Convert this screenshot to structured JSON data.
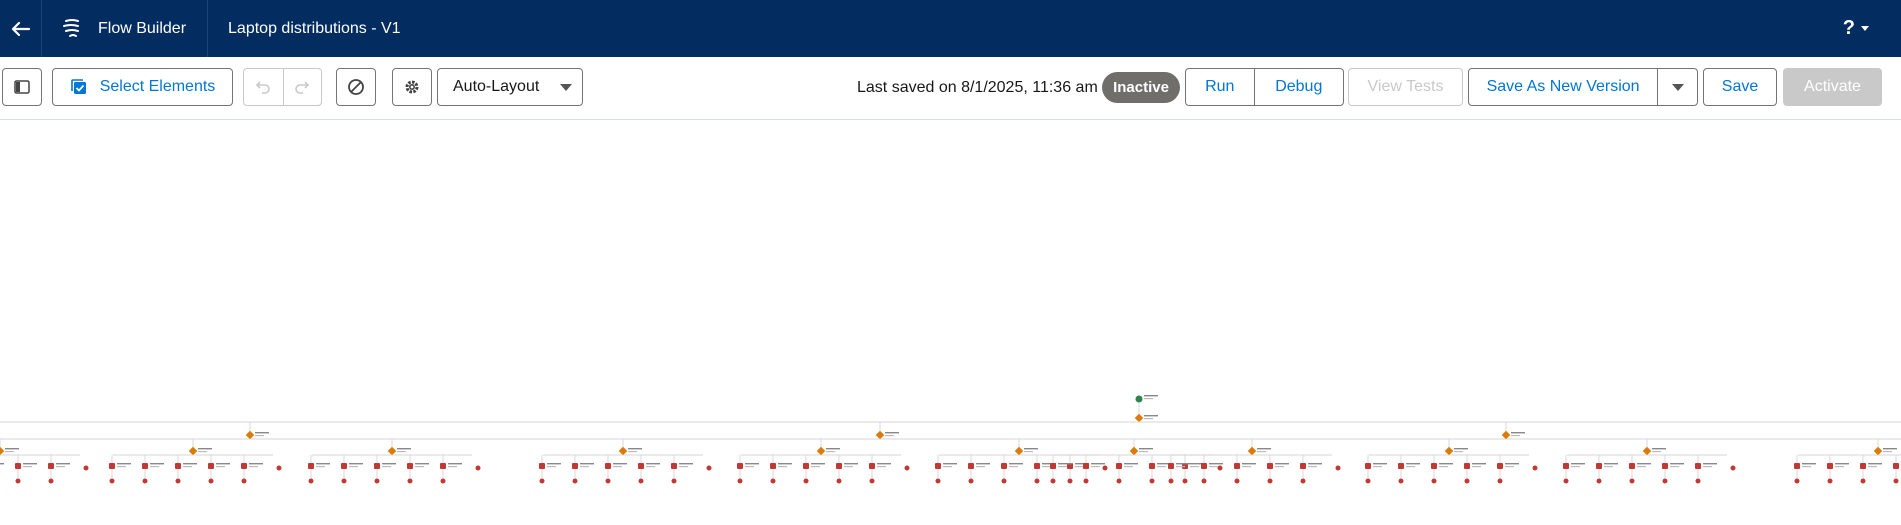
{
  "header": {
    "app_name": "Flow Builder",
    "flow_title": "Laptop distributions - V1",
    "help_label": "?"
  },
  "toolbar": {
    "select_elements_label": "Select Elements",
    "layout_label": "Auto-Layout",
    "last_saved": "Last saved on 8/1/2025, 11:36 am",
    "status_badge": "Inactive",
    "run_label": "Run",
    "debug_label": "Debug",
    "view_tests_label": "View Tests",
    "save_new_version_label": "Save As New Version",
    "save_label": "Save",
    "activate_label": "Activate"
  },
  "colors": {
    "header_bg": "#032d60",
    "brand_blue": "#0176d3",
    "badge_gray": "#706e6b",
    "start_node": "#2e844a",
    "decision_node": "#dd7a01",
    "action_node": "#c23934"
  },
  "canvas": {
    "flow_structure": {
      "start_nodes": 1,
      "level1_decisions": 1,
      "level2_decisions": 3,
      "level3_decisions": 12,
      "actions_per_level3_decision": 5
    }
  }
}
